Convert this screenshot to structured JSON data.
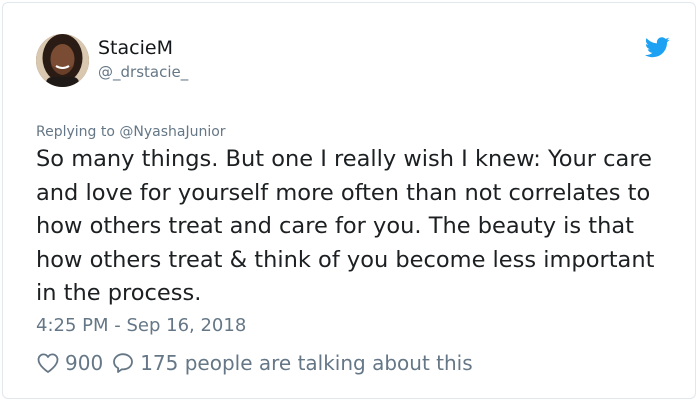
{
  "tweet": {
    "author": {
      "display_name": "StacieM",
      "handle": "@_drstacie_"
    },
    "reply_context": {
      "prefix": "Replying to",
      "mention": "@NyashaJunior"
    },
    "text": "So many things. But one I really wish I knew: Your care and love for yourself more often than not correlates to how others treat and care for you. The beauty is that how others treat & think of you become less important in the process.",
    "timestamp": "4:25 PM - Sep 16, 2018",
    "likes": "900",
    "replies_text": "175 people are talking about this"
  },
  "colors": {
    "twitter_blue": "#1da1f2",
    "secondary_text": "#657786",
    "primary_text": "#1c2022",
    "border": "#e1e8ed"
  },
  "icons": {
    "brand": "twitter-bird-icon",
    "like": "heart-icon",
    "reply": "speech-bubble-icon"
  }
}
